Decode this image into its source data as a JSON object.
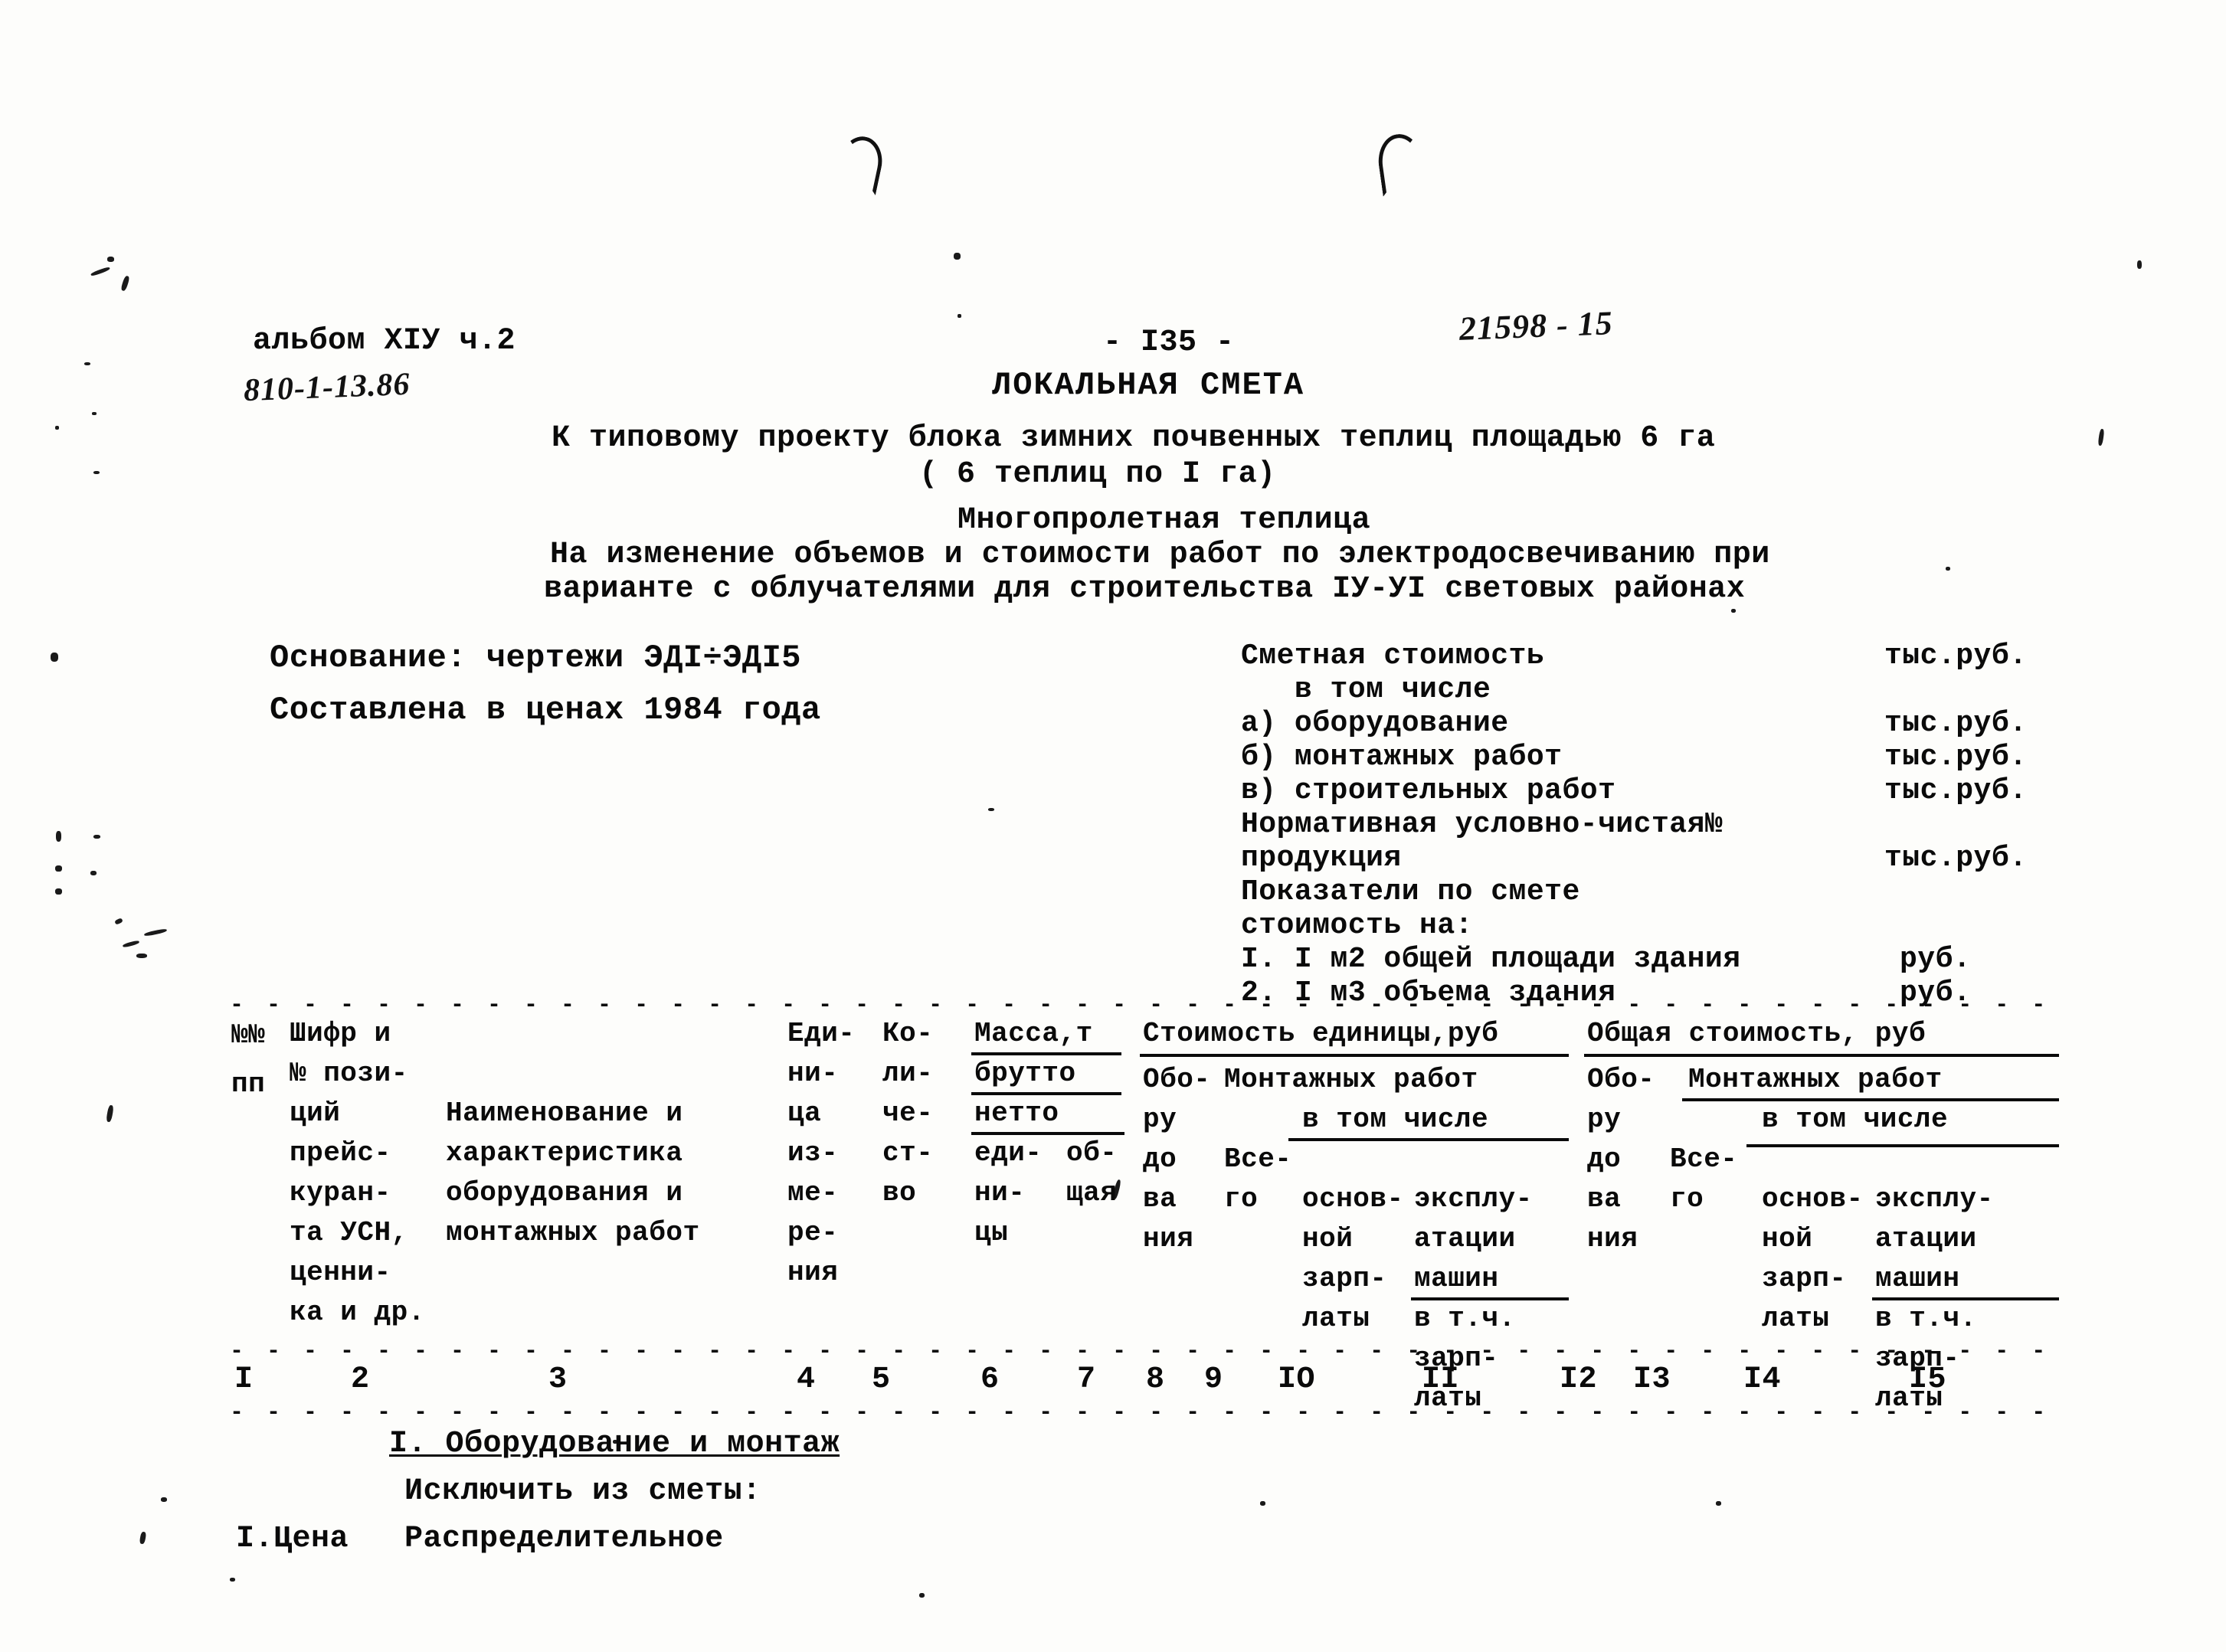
{
  "document": {
    "album_label": "альбом XIУ ч.2",
    "album_handwritten": "810-1-13.86",
    "page_number": "- I35 -",
    "doc_code_handwritten": "21598 - 15",
    "title": "ЛОКАЛЬНАЯ СМЕТА",
    "subtitle_line1": "К типовому проекту блока зимних почвенных теплиц площадью 6 га",
    "subtitle_line2": "( 6 теплиц по I га)",
    "subtitle_line3": "Многопролетная теплица",
    "subtitle_line4": "На изменение объемов и стоимости работ по электродосвечиванию при",
    "subtitle_line5": "варианте с облучателями для строительства IУ-УI световых районах"
  },
  "basis": {
    "line1": "Основание: чертежи ЭДI÷ЭДI5",
    "line2": "Составлена в ценах 1984 года"
  },
  "cost_summary": {
    "rows": [
      {
        "label": "Сметная стоимость",
        "unit": "тыс.руб."
      },
      {
        "label": "   в том числе",
        "unit": ""
      },
      {
        "label": "а) оборудование",
        "unit": "тыс.руб."
      },
      {
        "label": "б) монтажных работ",
        "unit": "тыс.руб."
      },
      {
        "label": "в) строительных работ",
        "unit": "тыс.руб."
      },
      {
        "label": "Нормативная условно-чистая№",
        "unit": ""
      },
      {
        "label": "продукция",
        "unit": "тыс.руб."
      },
      {
        "label": "Показатели по смете",
        "unit": ""
      },
      {
        "label": "стоимость на:",
        "unit": ""
      },
      {
        "label": "I. I м2 общей площади здания",
        "unit": "руб."
      },
      {
        "label": "2. I м3 объема здания",
        "unit": "руб."
      }
    ]
  },
  "table": {
    "header": {
      "col1": [
        "№№",
        "пп"
      ],
      "col2": [
        "Шифр и",
        "№ пози-",
        "ций",
        "прейс-",
        "куран-",
        "та УСН,",
        "ценни-",
        "ка и др."
      ],
      "col3": [
        "Наименование и",
        "характеристика",
        "оборудования и",
        "монтажных работ"
      ],
      "col4": [
        "Еди-",
        "ни-",
        "ца",
        "из-",
        "ме-",
        "ре-",
        "ния"
      ],
      "col5": [
        "Ко-",
        "ли-",
        "че-",
        "ст-",
        "во"
      ],
      "col6_group": "Масса,т",
      "col6_brutto": "брутто",
      "col6_netto": "нетто",
      "col6_sub1": [
        "еди-",
        "ни-",
        "цы"
      ],
      "col6_sub2": [
        "об-",
        "щая"
      ],
      "group_unit_cost": "Стоимость единицы,руб",
      "group_total_cost": "Общая стоимость, руб",
      "equipment": [
        "Обо-",
        "ру",
        "до",
        "ва",
        "ния"
      ],
      "install_works": "Монтажных работ",
      "among_which": "в том числе",
      "total": [
        "Все-",
        "го"
      ],
      "base_salary": [
        "основ-",
        "ной",
        "зарп-",
        "латы"
      ],
      "machine_operation": [
        "эксплу-",
        "атации",
        "машин"
      ],
      "machine_sub": [
        "в т.ч.",
        "зарп-",
        "латы"
      ]
    },
    "column_numbers": [
      "I",
      "2",
      "3",
      "4",
      "5",
      "6",
      "7",
      "8",
      "9",
      "IO",
      "II",
      "I2",
      "I3",
      "I4",
      "I5"
    ],
    "body_rows": [
      {
        "c1": "",
        "c2": "",
        "c3": "I. Оборудование и монтаж",
        "underline": true
      },
      {
        "c1": "",
        "c2": "",
        "c3": "Исключить из сметы:",
        "underline": false
      },
      {
        "c1": "",
        "c2": "I.Цена",
        "c3": "Распределительное",
        "underline": false
      }
    ]
  }
}
